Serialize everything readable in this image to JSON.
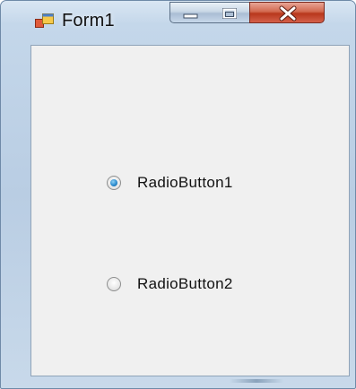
{
  "window": {
    "title": "Form1",
    "icon": "form-icon",
    "controls": {
      "minimize_icon": "minimize-icon",
      "maximize_icon": "maximize-icon",
      "close_icon": "close-icon"
    }
  },
  "form": {
    "radio_buttons": [
      {
        "label": "RadioButton1",
        "checked": true
      },
      {
        "label": "RadioButton2",
        "checked": false
      }
    ]
  },
  "colors": {
    "close_button": "#c9452b",
    "radio_selected": "#2b8ccf"
  }
}
